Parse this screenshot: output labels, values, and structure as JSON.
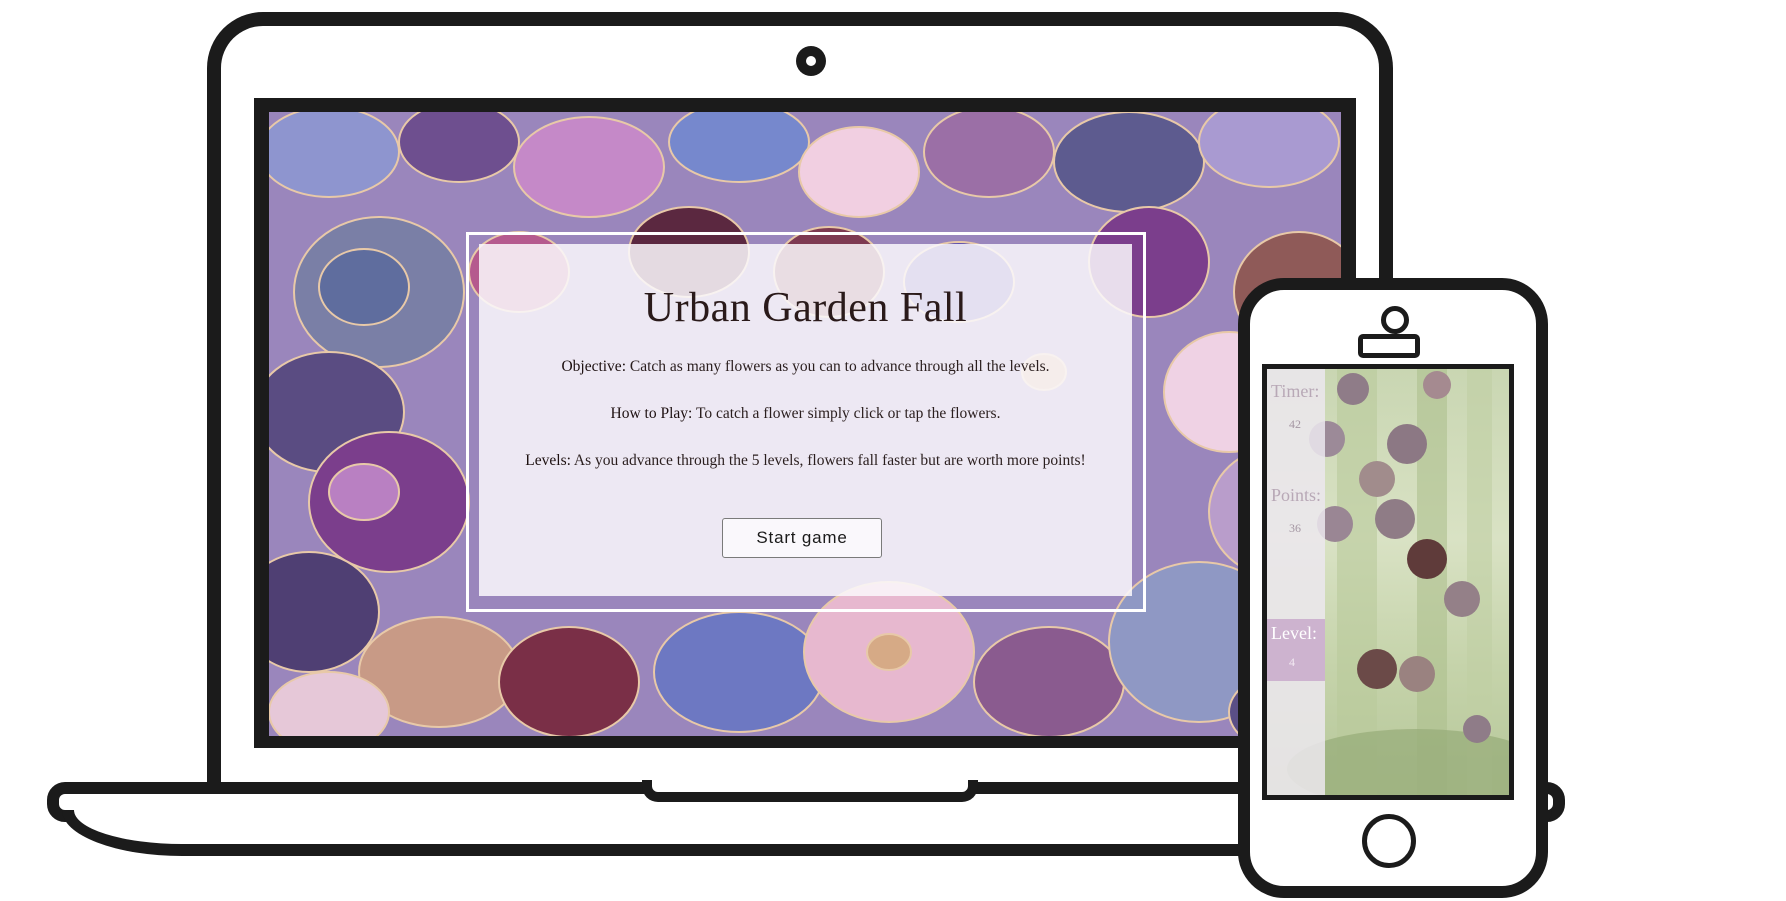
{
  "desktop": {
    "title": "Urban Garden Fall",
    "paragraphs": [
      {
        "label": "Objective:",
        "text": " Catch as many flowers as you can to advance through all the levels."
      },
      {
        "label": "How to Play:",
        "text": " To catch a flower simply click or tap the flowers."
      },
      {
        "label": "Levels:",
        "text": " As you advance through the 5 levels, flowers fall faster but are worth more points!"
      }
    ],
    "start_button": "Start game"
  },
  "mobile": {
    "timer_label": "Timer:",
    "timer_value": "42",
    "points_label": "Points:",
    "points_value": "36",
    "level_label": "Level:",
    "level_value": "4"
  },
  "colors": {
    "device_outline": "#1b1b1b",
    "panel_bg": "#faf8fc",
    "level_box": "#cdb3cf"
  }
}
